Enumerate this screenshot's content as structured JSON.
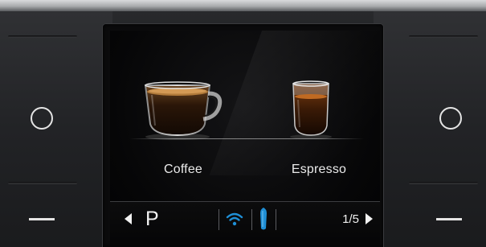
{
  "screen": {
    "products": [
      {
        "label": "Coffee",
        "icon": "coffee-cup-icon"
      },
      {
        "label": "Espresso",
        "icon": "espresso-glass-icon"
      }
    ],
    "status_bar": {
      "profile": "P",
      "page_indicator": "1/5",
      "icons": [
        "wifi-icon",
        "water-level-icon"
      ],
      "accent_color": "#1f8fd6"
    }
  },
  "hardware": {
    "left_buttons": [
      "circle-button-icon",
      "minus-button-icon"
    ],
    "right_buttons": [
      "circle-button-icon",
      "minus-button-icon"
    ]
  }
}
